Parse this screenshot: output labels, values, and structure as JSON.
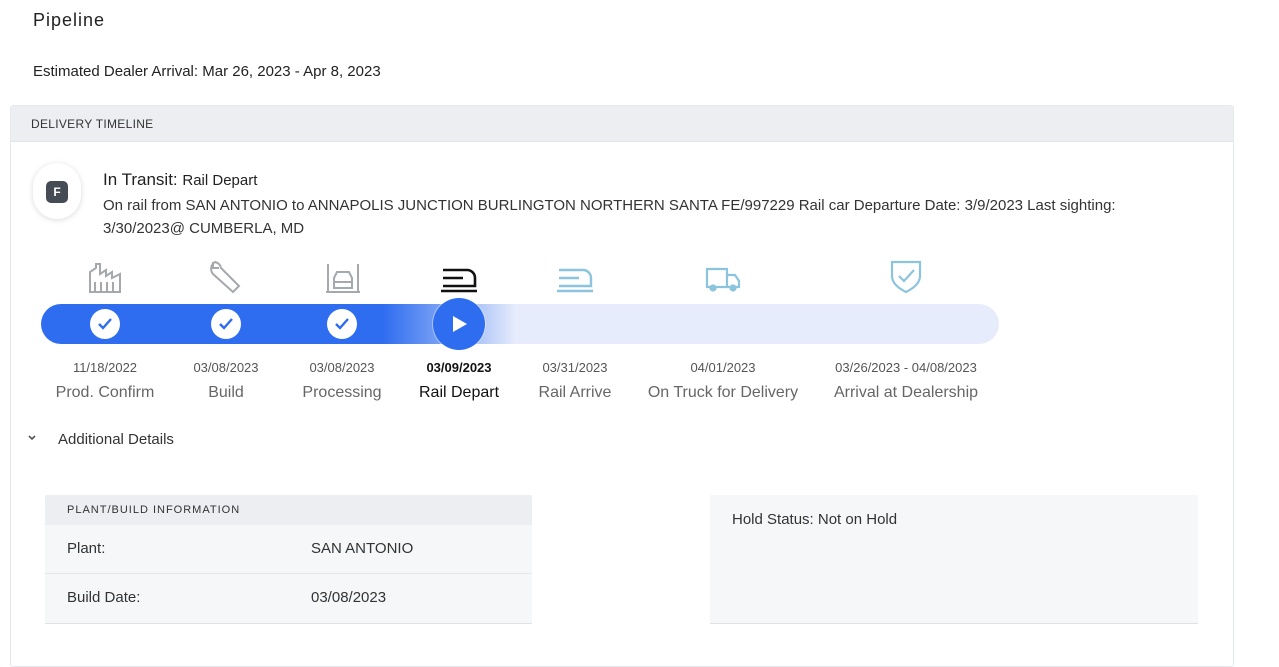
{
  "page": {
    "title": "Pipeline",
    "estimated_arrival": "Estimated Dealer Arrival: Mar 26, 2023 - Apr 8, 2023"
  },
  "timeline": {
    "header": "DELIVERY TIMELINE",
    "badge_letter": "F",
    "status_main": "In Transit:",
    "status_sub": "Rail Depart",
    "status_desc": "On rail from SAN ANTONIO to ANNAPOLIS JUNCTION BURLINGTON NORTHERN SANTA FE/997229 Rail car Departure Date: 3/9/2023 Last sighting: 3/30/2023@ CUMBERLA, MD",
    "steps": [
      {
        "date": "11/18/2022",
        "label": "Prod. Confirm",
        "state": "done",
        "icon": "factory-icon"
      },
      {
        "date": "03/08/2023",
        "label": "Build",
        "state": "done",
        "icon": "wrench-icon"
      },
      {
        "date": "03/08/2023",
        "label": "Processing",
        "state": "done",
        "icon": "vehicle-processing-icon"
      },
      {
        "date": "03/09/2023",
        "label": "Rail Depart",
        "state": "current",
        "icon": "rail-depart-icon"
      },
      {
        "date": "03/31/2023",
        "label": "Rail Arrive",
        "state": "upcoming",
        "icon": "rail-arrive-icon"
      },
      {
        "date": "04/01/2023",
        "label": "On Truck for Delivery",
        "state": "upcoming",
        "icon": "truck-icon"
      },
      {
        "date": "03/26/2023 - 04/08/2023",
        "label": "Arrival at Dealership",
        "state": "upcoming",
        "icon": "shield-check-icon"
      }
    ]
  },
  "details": {
    "toggle_label": "Additional Details",
    "plant_header": "PLANT/BUILD INFORMATION",
    "rows": [
      {
        "key": "Plant:",
        "value": "SAN ANTONIO"
      },
      {
        "key": "Build Date:",
        "value": "03/08/2023"
      }
    ],
    "hold_status": "Hold Status: Not on Hold"
  },
  "colors": {
    "accent": "#2f6df0",
    "track_bg": "#e6ecfb",
    "done_icon": "#a5a8ad",
    "upcoming_icon": "#8cc4de"
  }
}
